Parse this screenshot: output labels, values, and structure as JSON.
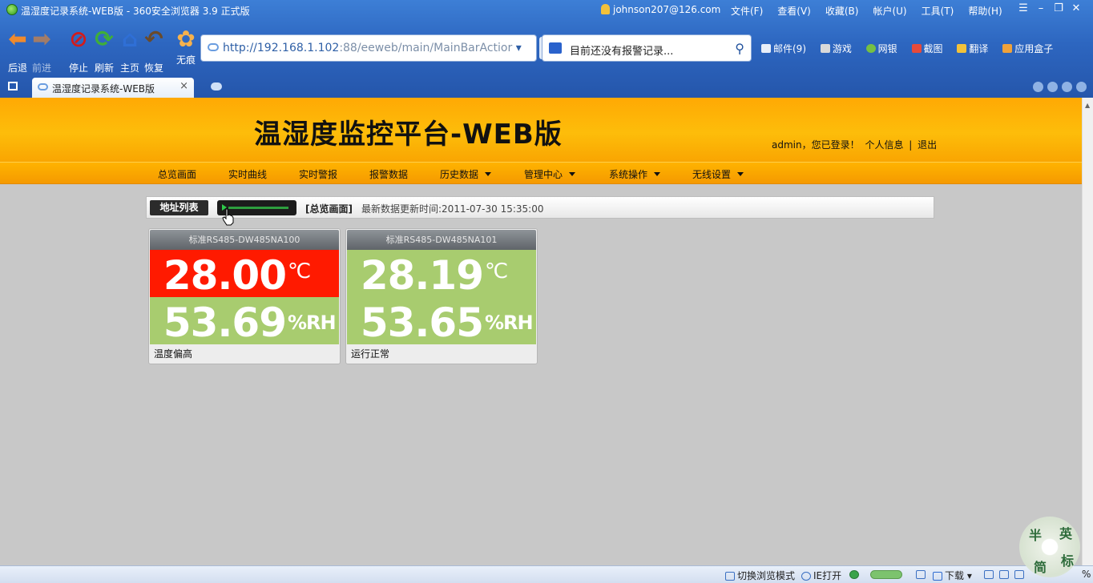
{
  "browser": {
    "window_title": "温湿度记录系统-WEB版 - 360安全浏览器 3.9 正式版",
    "user": "johnson207@126.com",
    "menu": [
      "文件(F)",
      "查看(V)",
      "收藏(B)",
      "帐户(U)",
      "工具(T)",
      "帮助(H)"
    ],
    "nav": {
      "back": "后退",
      "forward": "前进",
      "stop": "停止",
      "refresh": "刷新",
      "home": "主页",
      "restore": "恢复",
      "no_trace": "无痕"
    },
    "url_host": "http://192.168.1.102",
    "url_rest": ":88/eeweb/main/MainBarActior",
    "search_text": "目前还没有报警记录...",
    "tools": [
      "邮件(9)",
      "游戏",
      "网银",
      "截图",
      "翻译",
      "应用盒子"
    ],
    "tab_title": "温湿度记录系统-WEB版",
    "tab_close": "×"
  },
  "page": {
    "title": "温湿度监控平台-WEB版",
    "login": {
      "user": "admin，您已登录！",
      "profile": "个人信息",
      "sep": "|",
      "logout": "退出"
    },
    "nav": [
      {
        "label": "总览画面",
        "dropdown": false
      },
      {
        "label": "实时曲线",
        "dropdown": false
      },
      {
        "label": "实时警报",
        "dropdown": false
      },
      {
        "label": "报警数据",
        "dropdown": false
      },
      {
        "label": "历史数据",
        "dropdown": true
      },
      {
        "label": "管理中心",
        "dropdown": true
      },
      {
        "label": "系统操作",
        "dropdown": true
      },
      {
        "label": "无线设置",
        "dropdown": true
      }
    ],
    "toolbar": {
      "address_list": "地址列表",
      "crumb": "[总览画面]",
      "updated": "最新数据更新时间:2011-07-30 15:35:00"
    },
    "devices": [
      {
        "name": "标准RS485-DW485NA100",
        "temp": "28.00",
        "temp_unit": "℃",
        "hum": "53.69",
        "hum_unit": "%RH",
        "status": "温度偏高",
        "temp_color": "#ff1a00"
      },
      {
        "name": "标准RS485-DW485NA101",
        "temp": "28.19",
        "temp_unit": "℃",
        "hum": "53.65",
        "hum_unit": "%RH",
        "status": "运行正常",
        "temp_color": "#a8cc6f"
      }
    ]
  },
  "statusbar": {
    "mode": "切换浏览模式",
    "ie": "IE打开",
    "download": "下载",
    "zoom": "%"
  },
  "watermark": [
    "半",
    "英",
    "简",
    "标"
  ]
}
